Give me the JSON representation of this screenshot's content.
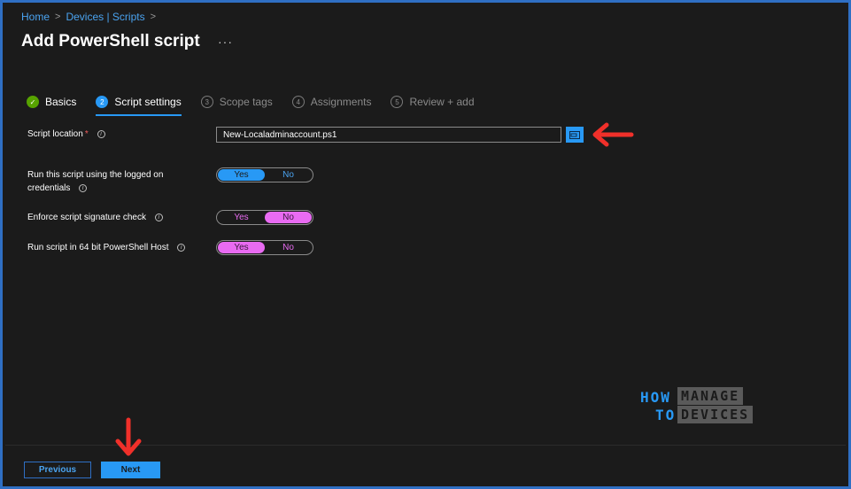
{
  "breadcrumb": {
    "home": "Home",
    "devices": "Devices | Scripts",
    "sep": ">"
  },
  "page": {
    "title": "Add PowerShell script",
    "more": "···"
  },
  "tabs": [
    {
      "num": "✓",
      "label": "Basics",
      "state": "done"
    },
    {
      "num": "2",
      "label": "Script settings",
      "state": "current"
    },
    {
      "num": "3",
      "label": "Scope tags",
      "state": "pending"
    },
    {
      "num": "4",
      "label": "Assignments",
      "state": "pending"
    },
    {
      "num": "5",
      "label": "Review + add",
      "state": "pending"
    }
  ],
  "form": {
    "script_location": {
      "label": "Script location",
      "required_mark": "*",
      "value": "New-Localadminaccount.ps1"
    },
    "run_logged_on": {
      "label_line1": "Run this script using the logged on",
      "label_line2": "credentials",
      "yes": "Yes",
      "no": "No",
      "selected": "Yes"
    },
    "signature_check": {
      "label": "Enforce script signature check",
      "yes": "Yes",
      "no": "No",
      "selected": "No"
    },
    "run_64bit": {
      "label": "Run script in 64 bit PowerShell Host",
      "yes": "Yes",
      "no": "No",
      "selected": "Yes"
    }
  },
  "logo": {
    "how": "HOW",
    "to": "TO",
    "manage": "MANAGE",
    "devices": "DEVICES"
  },
  "footer": {
    "previous": "Previous",
    "next": "Next"
  },
  "colors": {
    "accent": "#2899f5",
    "success": "#57a300",
    "highlight": "#e96bf2",
    "annotation_arrow": "#f0302a"
  }
}
